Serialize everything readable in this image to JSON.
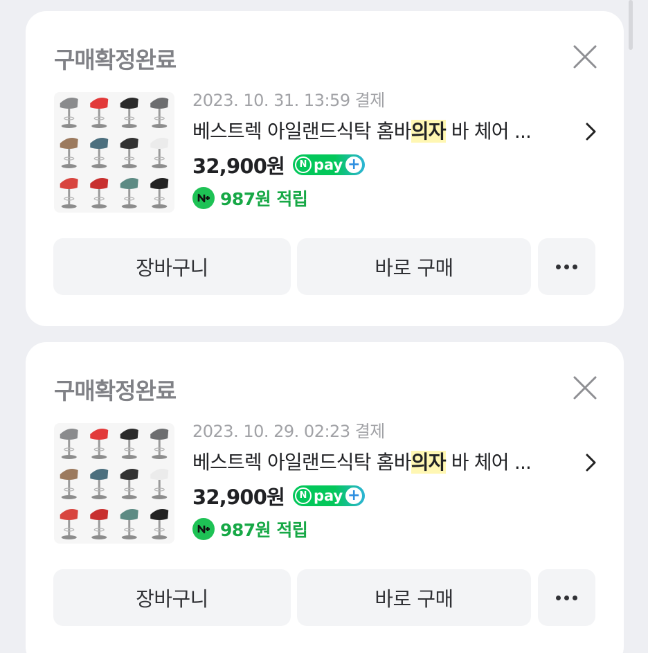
{
  "orders": [
    {
      "status": "구매확정완료",
      "date": "2023. 10. 31. 13:59 결제",
      "title_before": "베스트렉 아일랜드식탁 홈바",
      "title_highlight": "의자",
      "title_after": " 바 체어 ...",
      "price": "32,900원",
      "npay_label": "pay",
      "point": "987원 적립",
      "cart_label": "장바구니",
      "buy_label": "바로 구매"
    },
    {
      "status": "구매확정완료",
      "date": "2023. 10. 29. 02:23 결제",
      "title_before": "베스트렉 아일랜드식탁 홈바",
      "title_highlight": "의자",
      "title_after": " 바 체어 ...",
      "price": "32,900원",
      "npay_label": "pay",
      "point": "987원 적립",
      "cart_label": "장바구니",
      "buy_label": "바로 구매"
    }
  ],
  "icons": {
    "close": "close-icon",
    "chevron": "chevron-right-icon",
    "more": "more-horizontal-icon",
    "npay": "npay-plus-badge",
    "point": "npay-point-icon"
  },
  "colors": {
    "background": "#eeeff3",
    "card": "#ffffff",
    "status_text": "#808186",
    "date_text": "#a1a2a6",
    "highlight": "#fff7b3",
    "point_green": "#17a846",
    "npay_green": "#03c75a",
    "button_bg": "#f3f4f6"
  },
  "product_thumbnail_chairs": [
    [
      "#8a8b8d",
      "#e23a3a",
      "#2b2b2b",
      "#6d6e70"
    ],
    [
      "#9c7a5e",
      "#4c6f7e",
      "#333333",
      "#ebebeb"
    ],
    [
      "#d8453f",
      "#c8302f",
      "#5d8b84",
      "#222222"
    ]
  ]
}
